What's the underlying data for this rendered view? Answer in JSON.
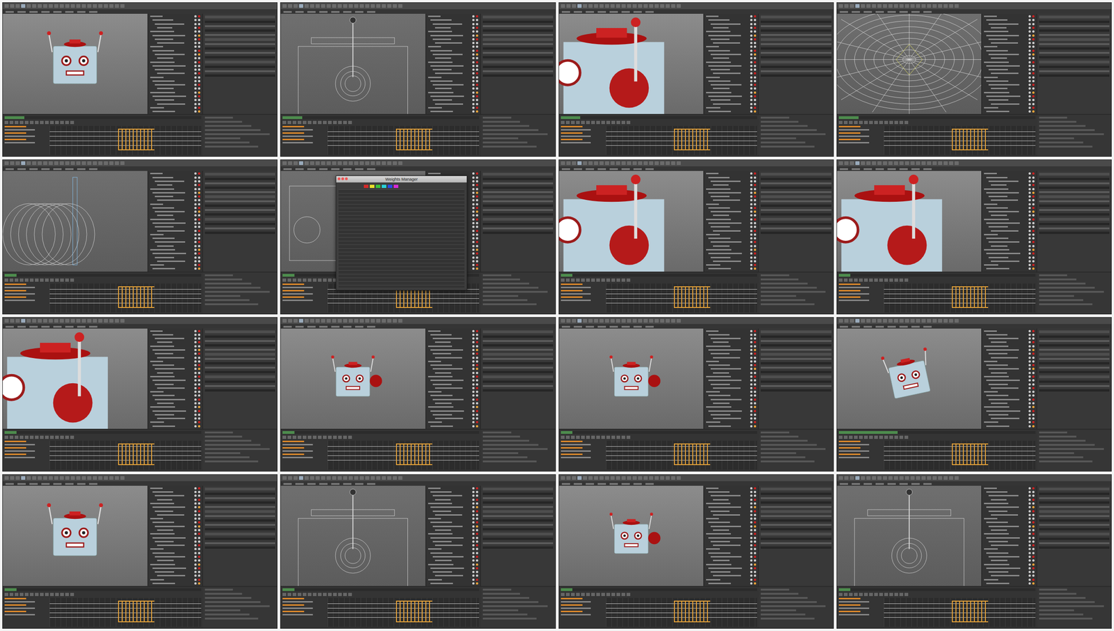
{
  "frames": [
    {
      "kind": "robot-front",
      "level": 0.1
    },
    {
      "kind": "wire-side",
      "level": 0.1
    },
    {
      "kind": "robot-closeup",
      "level": 0.1
    },
    {
      "kind": "wire-top",
      "level": 0.1
    },
    {
      "kind": "wire-close",
      "level": 0.06
    },
    {
      "kind": "wire-box",
      "level": 0.06,
      "dialog": {
        "title": "Weights Manager",
        "colors": [
          "#d42a2a",
          "#e8e02a",
          "#3ac43a",
          "#2ad0d8",
          "#2a4ae8",
          "#d82ad8"
        ]
      }
    },
    {
      "kind": "robot-closeup",
      "level": 0.06
    },
    {
      "kind": "robot-closeup",
      "level": 0.06
    },
    {
      "kind": "robot-closeup",
      "level": 0.06
    },
    {
      "kind": "robot-small",
      "level": 0.06
    },
    {
      "kind": "robot-small",
      "level": 0.06
    },
    {
      "kind": "robot-tilt",
      "level": 0.3
    },
    {
      "kind": "robot-front",
      "level": 0.06
    },
    {
      "kind": "wire-side",
      "level": 0.06
    },
    {
      "kind": "robot-small",
      "level": 0.06
    },
    {
      "kind": "wire-side",
      "level": 0.06
    }
  ]
}
